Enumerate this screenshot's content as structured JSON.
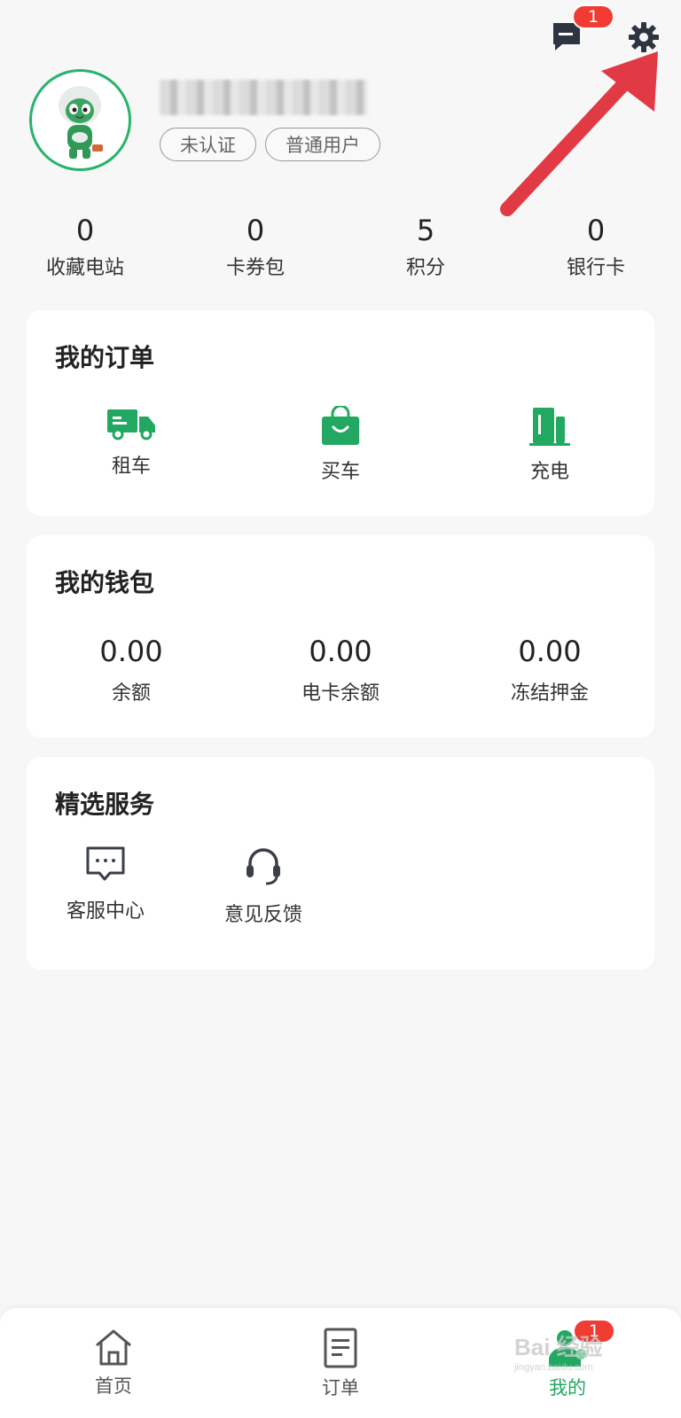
{
  "header": {
    "message_badge": "1"
  },
  "profile": {
    "tags": [
      "未认证",
      "普通用户"
    ]
  },
  "stats": [
    {
      "value": "0",
      "label": "收藏电站"
    },
    {
      "value": "0",
      "label": "卡券包"
    },
    {
      "value": "5",
      "label": "积分"
    },
    {
      "value": "0",
      "label": "银行卡"
    }
  ],
  "orders": {
    "title": "我的订单",
    "items": [
      {
        "label": "租车",
        "icon": "truck-icon"
      },
      {
        "label": "买车",
        "icon": "shopping-bag-icon"
      },
      {
        "label": "充电",
        "icon": "charging-station-icon"
      }
    ]
  },
  "wallet": {
    "title": "我的钱包",
    "items": [
      {
        "amount": "0.00",
        "label": "余额"
      },
      {
        "amount": "0.00",
        "label": "电卡余额"
      },
      {
        "amount": "0.00",
        "label": "冻结押金"
      }
    ]
  },
  "services": {
    "title": "精选服务",
    "items": [
      {
        "label": "客服中心",
        "icon": "chat-bubble-icon"
      },
      {
        "label": "意见反馈",
        "icon": "headset-icon"
      }
    ]
  },
  "tabbar": {
    "tabs": [
      {
        "label": "首页",
        "icon": "home-icon"
      },
      {
        "label": "订单",
        "icon": "document-icon"
      },
      {
        "label": "我的",
        "icon": "user-icon",
        "active": true,
        "badge": "1"
      }
    ]
  },
  "watermark": {
    "text": "Bai 经验",
    "sub": "jingyan.baidu.com"
  },
  "colors": {
    "accent": "#22a861",
    "badge": "#f03c32",
    "arrow": "#e23a45"
  }
}
